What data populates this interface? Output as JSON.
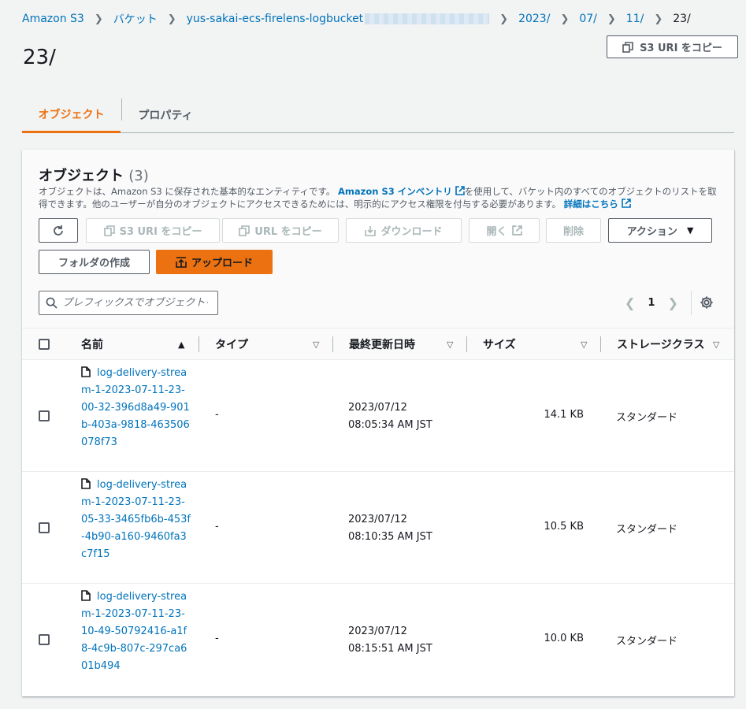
{
  "breadcrumb": {
    "items": [
      "Amazon S3",
      "バケット",
      "yus-sakai-ecs-firelens-logbucket",
      "2023/",
      "07/",
      "11/"
    ],
    "current": "23/"
  },
  "page_title": "23/",
  "header_actions": {
    "copy_s3_uri": "S3 URI をコピー"
  },
  "tabs": [
    {
      "label": "オブジェクト",
      "active": true
    },
    {
      "label": "プロパティ",
      "active": false
    }
  ],
  "objects_panel": {
    "title": "オブジェクト",
    "count": "(3)",
    "description": {
      "part1": "オブジェクトは、Amazon S3 に保存された基本的なエンティティです。",
      "inventory_link": "Amazon S3 インベントリ",
      "part2": "を使用して、バケット内のすべてのオブジェクトのリストを取得できます。他のユーザーが自分のオブジェクトにアクセスできるためには、明示的にアクセス権限を付与する必要があります。",
      "learn_more": "詳細はこちら"
    },
    "toolbar": {
      "copy_s3_uri": "S3 URI をコピー",
      "copy_url": "URL をコピー",
      "download": "ダウンロード",
      "open": "開く",
      "delete": "削除",
      "actions": "アクション",
      "create_folder": "フォルダの作成",
      "upload": "アップロード"
    },
    "search_placeholder": "プレフィックスでオブジェクトを検索",
    "pagination": {
      "current_page": "1"
    }
  },
  "table": {
    "columns": [
      "名前",
      "タイプ",
      "最終更新日時",
      "サイズ",
      "ストレージクラス"
    ],
    "rows": [
      {
        "name": "log-delivery-stream-1-2023-07-11-23-00-32-396d8a49-901b-403a-9818-463506078f73",
        "type": "-",
        "modified_date": "2023/07/12",
        "modified_time": "08:05:34 AM JST",
        "size": "14.1 KB",
        "storage_class": "スタンダード"
      },
      {
        "name": "log-delivery-stream-1-2023-07-11-23-05-33-3465fb6b-453f-4b90-a160-9460fa3c7f15",
        "type": "-",
        "modified_date": "2023/07/12",
        "modified_time": "08:10:35 AM JST",
        "size": "10.5 KB",
        "storage_class": "スタンダード"
      },
      {
        "name": "log-delivery-stream-1-2023-07-11-23-10-49-50792416-a1f8-4c9b-807c-297ca601b494",
        "type": "-",
        "modified_date": "2023/07/12",
        "modified_time": "08:15:51 AM JST",
        "size": "10.0 KB",
        "storage_class": "スタンダード"
      }
    ]
  },
  "colors": {
    "accent": "#ec7211",
    "link": "#0073bb",
    "text": "#16191f",
    "muted": "#545b64"
  }
}
